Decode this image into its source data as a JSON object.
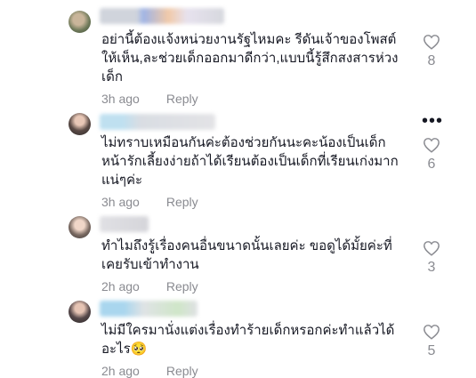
{
  "comments": [
    {
      "text": "อย่านี้ต้องแจ้งหน่วยงานรัฐไหมคะ รีดันเจ้าของโพสต์ให้เห็น,ละช่วยเด็กออกมาดีกว่า,แบบนี้รู้สึกสงสารห่วงเด็ก",
      "time": "3h ago",
      "reply": "Reply",
      "likes": "8"
    },
    {
      "text": "ไม่ทราบเหมือนกันค่ะต้องช่วยกันนะคะน้องเป็นเด็กหน้ารักเลี้ยงง่ายถ้าได้เรียนต้องเป็นเด็กที่เรียนเก่งมากแน่ๆค่ะ",
      "time": "3h ago",
      "reply": "Reply",
      "likes": "6"
    },
    {
      "text": "ทำไมถึงรู้เรื่องคนอื่นขนาดนั้นเลยค่ะ ขอดูได้มั้ยค่ะที่เคยรับเข้าทำงาน",
      "time": "2h ago",
      "reply": "Reply",
      "likes": "3"
    },
    {
      "text": "ไม่มีใครมานั่งแต่งเรื่องทำร้ายเด็กหรอกค่ะทำแล้วได้อะไร🥺",
      "time": "2h ago",
      "reply": "Reply",
      "likes": "5"
    }
  ],
  "icons": {
    "like": "heart-outline-icon",
    "more": "more-options-icon"
  }
}
